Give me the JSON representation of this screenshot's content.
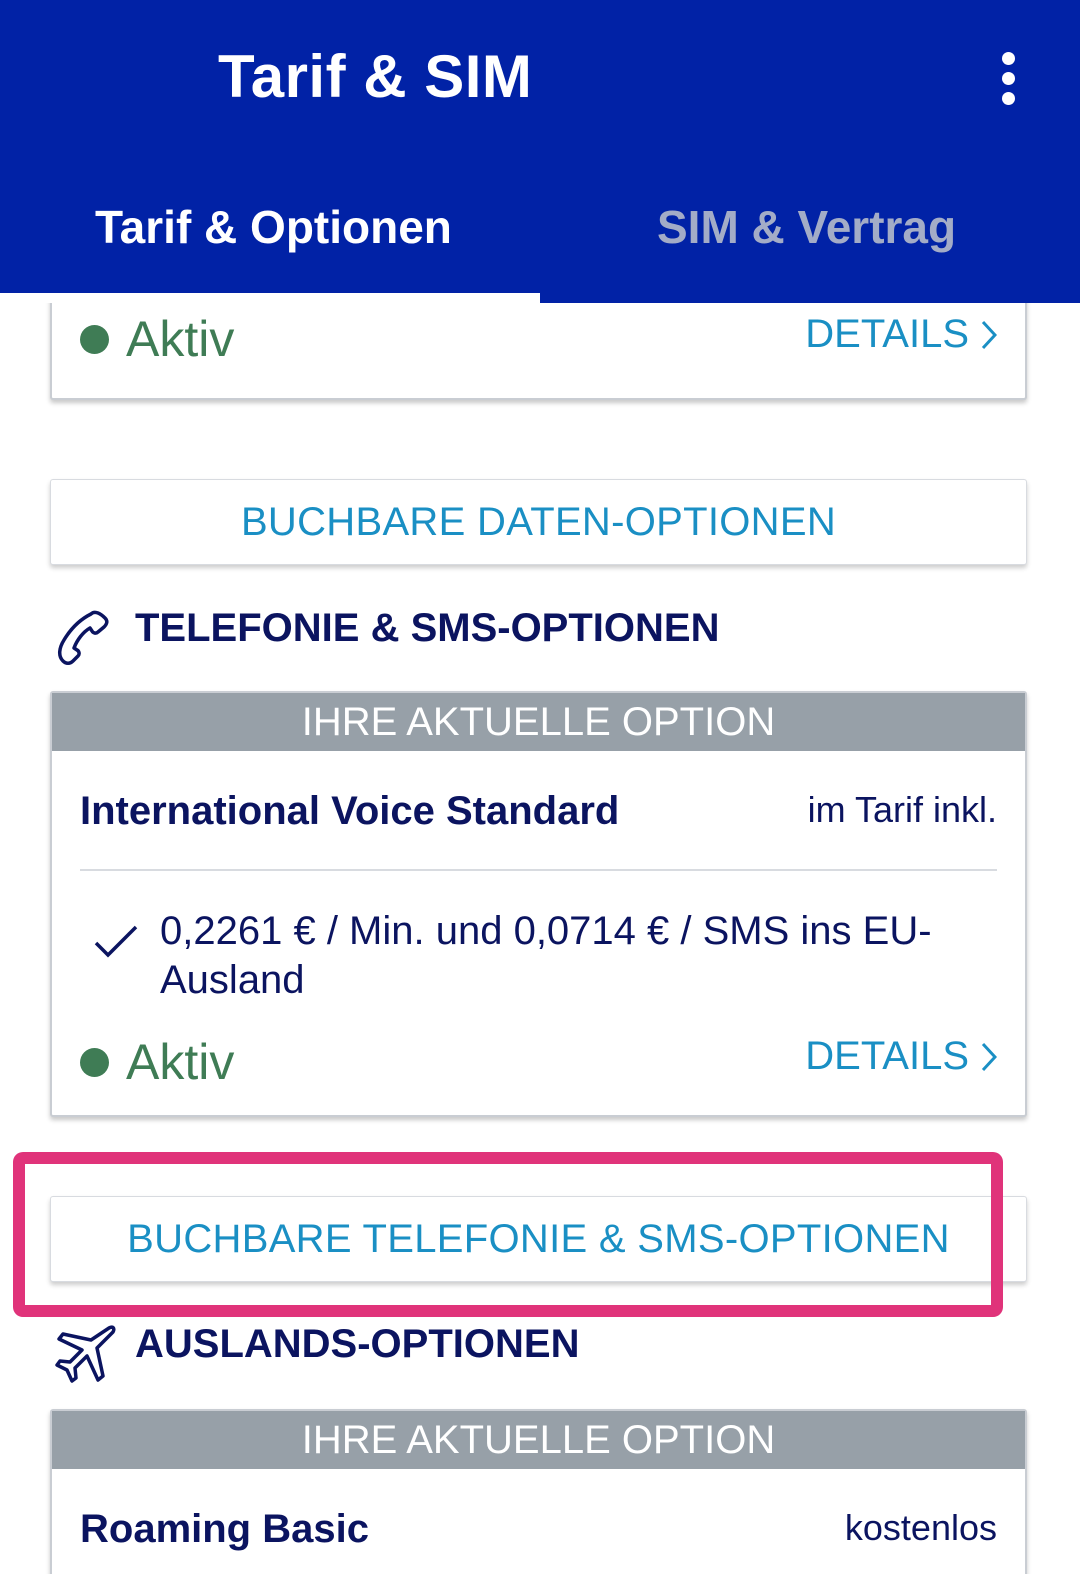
{
  "appbar": {
    "title": "Tarif & SIM",
    "menu_icon": "more-vertical-icon",
    "background": "#0122a6"
  },
  "tabs": [
    {
      "label": "Tarif & Optionen",
      "selected": true
    },
    {
      "label": "SIM & Vertrag",
      "selected": false
    }
  ],
  "top_card": {
    "status": "Aktiv",
    "details_label": "DETAILS"
  },
  "data_options_button": "BUCHBARE DATEN-OPTIONEN",
  "telephony_section": {
    "icon": "phone-icon",
    "heading": "TELEFONIE & SMS-OPTIONEN",
    "current_option_header": "IHRE AKTUELLE OPTION",
    "option_name": "International Voice Standard",
    "option_price": "im Tarif inkl.",
    "feature": "0,2261 € / Min. und 0,0714 € / SMS ins EU-Ausland",
    "status": "Aktiv",
    "details_label": "DETAILS"
  },
  "telephony_options_button": "BUCHBARE TELEFONIE & SMS-OPTIONEN",
  "abroad_section": {
    "icon": "airplane-icon",
    "heading": "AUSLANDS-OPTIONEN",
    "current_option_header": "IHRE AKTUELLE OPTION",
    "option_name": "Roaming Basic",
    "option_price": "kostenlos"
  },
  "colors": {
    "accent_link": "#1a8fc4",
    "status_green": "#3f7c55",
    "text_dark": "#0b1460",
    "highlight_border": "#e0337a"
  }
}
